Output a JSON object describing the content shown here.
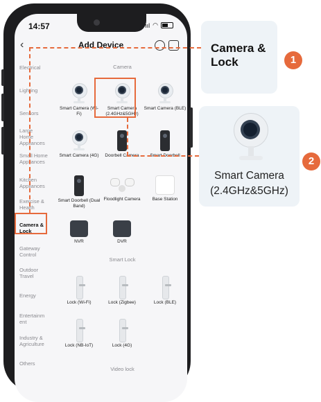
{
  "status": {
    "time": "14:57",
    "signal": "ııl"
  },
  "header": {
    "title": "Add Device",
    "back": "‹"
  },
  "sidebar": {
    "items": [
      {
        "label": "Electrical",
        "active": false
      },
      {
        "label": "Lighting",
        "active": false
      },
      {
        "label": "Sensors",
        "active": false
      },
      {
        "label": "Large Home Appliances",
        "active": false
      },
      {
        "label": "Small Home Appliances",
        "active": false
      },
      {
        "label": "Kitchen Appliances",
        "active": false
      },
      {
        "label": "Exercise & Health",
        "active": false
      },
      {
        "label": "Camera & Lock",
        "active": true
      },
      {
        "label": "Gateway Control",
        "active": false
      },
      {
        "label": "Outdoor Travel",
        "active": false
      },
      {
        "label": "Energy",
        "active": false
      },
      {
        "label": "Entertainm ent",
        "active": false
      },
      {
        "label": "Industry & Agriculture",
        "active": false
      },
      {
        "label": "Others",
        "active": false
      }
    ]
  },
  "sections": {
    "camera": "Camera",
    "smart_lock": "Smart Lock",
    "video_lock": "Video lock"
  },
  "devices": {
    "cam_wifi": "Smart Camera (Wi-Fi)",
    "cam_24_5": "Smart Camera (2.4GHz&5GHz)",
    "cam_ble": "Smart Camera (BLE)",
    "cam_4g": "Smart Camera (4G)",
    "doorbell_camera": "Doorbell Camera",
    "smart_doorbell": "Smart Doorbell",
    "smart_doorbell_dual": "Smart Doorbell (Dual Band)",
    "floodlight": "Floodlight Camera",
    "base_station": "Base Station",
    "nvr": "NVR",
    "dvr": "DVR",
    "lock_wifi": "Lock (Wi-Fi)",
    "lock_zigbee": "Lock (Zigbee)",
    "lock_ble": "Lock (BLE)",
    "lock_nbiot": "Lock (NB-IoT)",
    "lock_4g": "Lock (4G)"
  },
  "callouts": {
    "card1": "Camera & Lock",
    "card2": "Smart Camera (2.4GHz&5GHz)",
    "badge1": "1",
    "badge2": "2"
  },
  "colors": {
    "accent": "#e66a3c"
  }
}
